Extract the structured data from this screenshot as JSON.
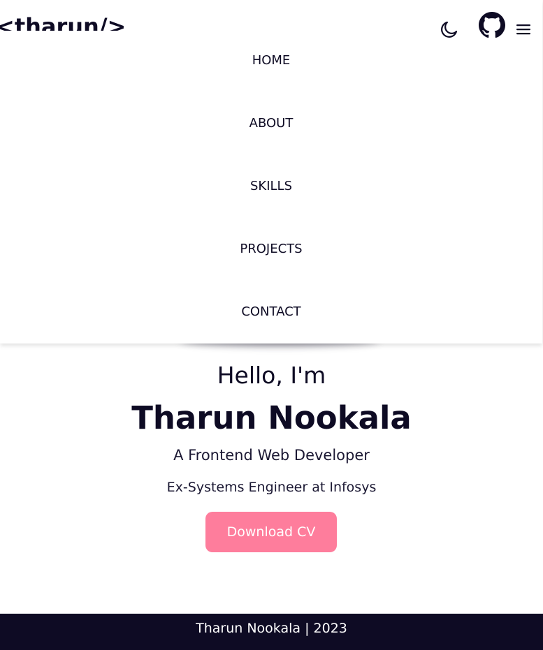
{
  "header": {
    "logo_text": "<tharun/>"
  },
  "menu": {
    "items": [
      {
        "label": "HOME"
      },
      {
        "label": "ABOUT"
      },
      {
        "label": "SKILLS"
      },
      {
        "label": "PROJECTS"
      },
      {
        "label": "CONTACT"
      }
    ]
  },
  "icons": {
    "theme_toggle": "moon-icon",
    "github": "github-icon",
    "menu": "hamburger-menu-icon"
  },
  "hero": {
    "greeting": "Hello, I'm",
    "name": "Tharun Nookala",
    "role": "A Frontend Web Developer",
    "experience": "Ex-Systems Engineer at Infosys",
    "cv_button_label": "Download CV"
  },
  "footer": {
    "text": "Tharun Nookala | 2023"
  },
  "colors": {
    "dark": "#0e0b24",
    "accent": "#fe7d9c",
    "background": "#ffffff"
  }
}
